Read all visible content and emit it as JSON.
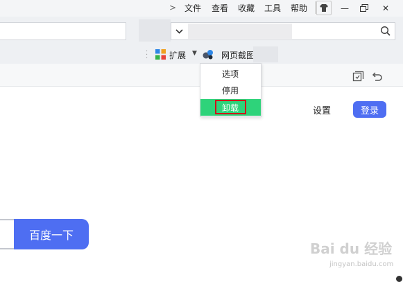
{
  "titlebar": {
    "menu": [
      "文件",
      "查看",
      "收藏",
      "工具",
      "帮助"
    ],
    "minimize": "—",
    "close": "✕"
  },
  "toolbar": {
    "extensions_label": "扩展",
    "screenshot_label": "网页截图"
  },
  "dropdown": {
    "items": [
      "选项",
      "停用",
      "卸载"
    ],
    "highlighted": "卸载",
    "highlight_color": "#2ed37a",
    "annotation_color": "#d0101a"
  },
  "page": {
    "settings_label": "设置",
    "login_label": "登录",
    "search_button_label": "百度一下",
    "accent_color": "#4e6ef2"
  },
  "watermark": {
    "logo_text": "Bai du 经验",
    "url": "jingyan.baidu.com"
  }
}
